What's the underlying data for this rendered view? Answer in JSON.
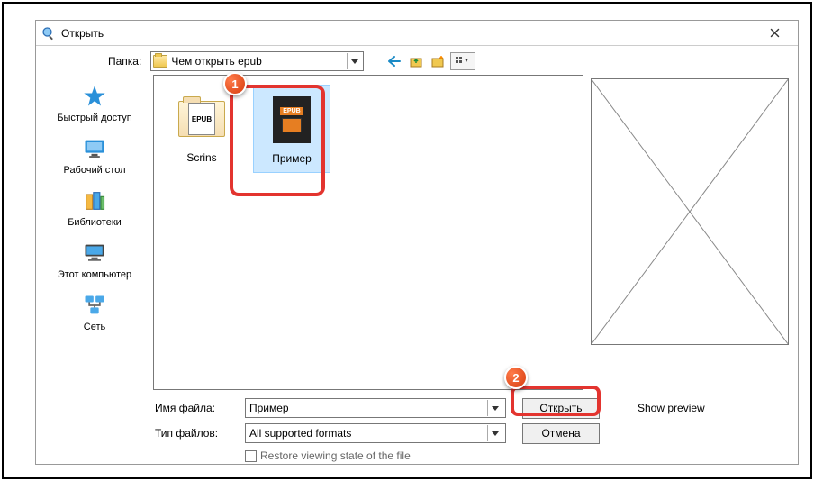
{
  "window": {
    "title": "Открыть"
  },
  "toolbar": {
    "folder_label": "Папка:",
    "folder_value": "Чем открыть epub"
  },
  "sidebar": {
    "items": [
      {
        "label": "Быстрый доступ"
      },
      {
        "label": "Рабочий стол"
      },
      {
        "label": "Библиотеки"
      },
      {
        "label": "Этот компьютер"
      },
      {
        "label": "Сеть"
      }
    ]
  },
  "files": [
    {
      "label": "Scrins",
      "type": "folder",
      "badge": "EPUB"
    },
    {
      "label": "Пример",
      "type": "epub",
      "badge": "EPUB"
    }
  ],
  "bottom": {
    "filename_label": "Имя файла:",
    "filename_value": "Пример",
    "filetype_label": "Тип файлов:",
    "filetype_value": "All supported formats",
    "open_label": "Открыть",
    "cancel_label": "Отмена",
    "restore_label": "Restore viewing state of the file",
    "show_preview_label": "Show preview"
  },
  "callouts": {
    "one": "1",
    "two": "2"
  }
}
